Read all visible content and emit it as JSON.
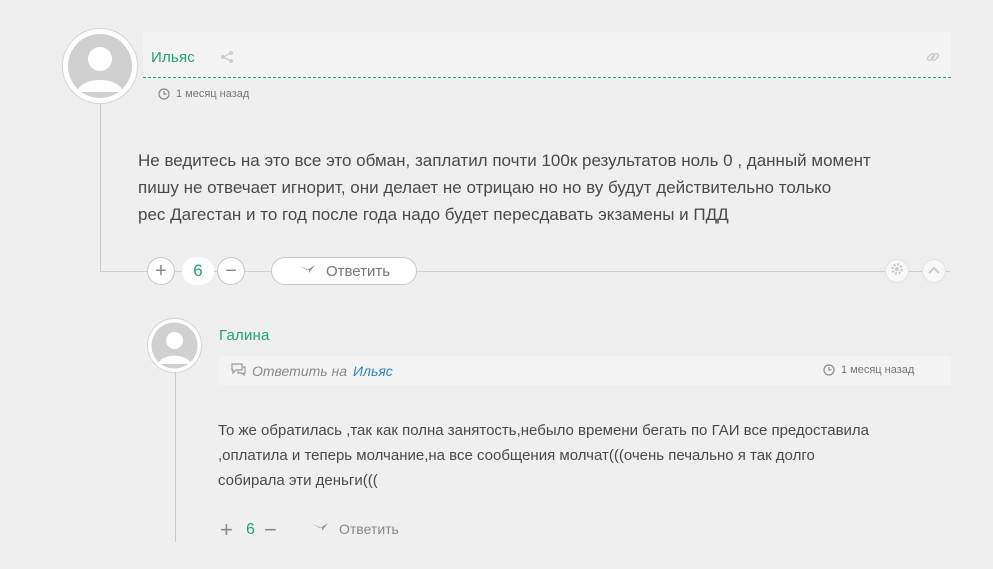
{
  "comment": {
    "author": "Ильяс",
    "time": "1 месяц назад",
    "text_lines": [
      "Не ведитесь на это все это обман, заплатил почти 100к результатов ноль 0 , данный момент",
      "пишу не отвечает игнорит, они делает не отрицаю но но ву будут действительно только",
      "рес Дагестан и то год после года надо будет пересдавать экзамены и ПДД"
    ],
    "upvote": "+",
    "score": "6",
    "downvote": "−",
    "reply_label": "Ответить"
  },
  "reply": {
    "author": "Галина",
    "reply_prefix": "Ответить на",
    "reply_to_name": "Ильяс",
    "time": "1 месяц назад",
    "text_lines": [
      "То же обратилась ,так как полна занятость,небыло времени бегать по ГАИ все предоставила",
      ",оплатила и теперь молчание,на все сообщения молчат(((очень печально я так долго",
      "собирала эти деньги((("
    ],
    "upvote": "+",
    "score": "6",
    "downvote": "−",
    "reply_label": "Ответить"
  },
  "colors": {
    "accent": "#1da27c",
    "link": "#2a86c8",
    "background": "#efefef"
  },
  "icons": [
    "share-icon",
    "link-icon",
    "clock-icon",
    "reply-arrow-icon",
    "gear-icon",
    "chevron-up-icon",
    "comment-icon"
  ]
}
